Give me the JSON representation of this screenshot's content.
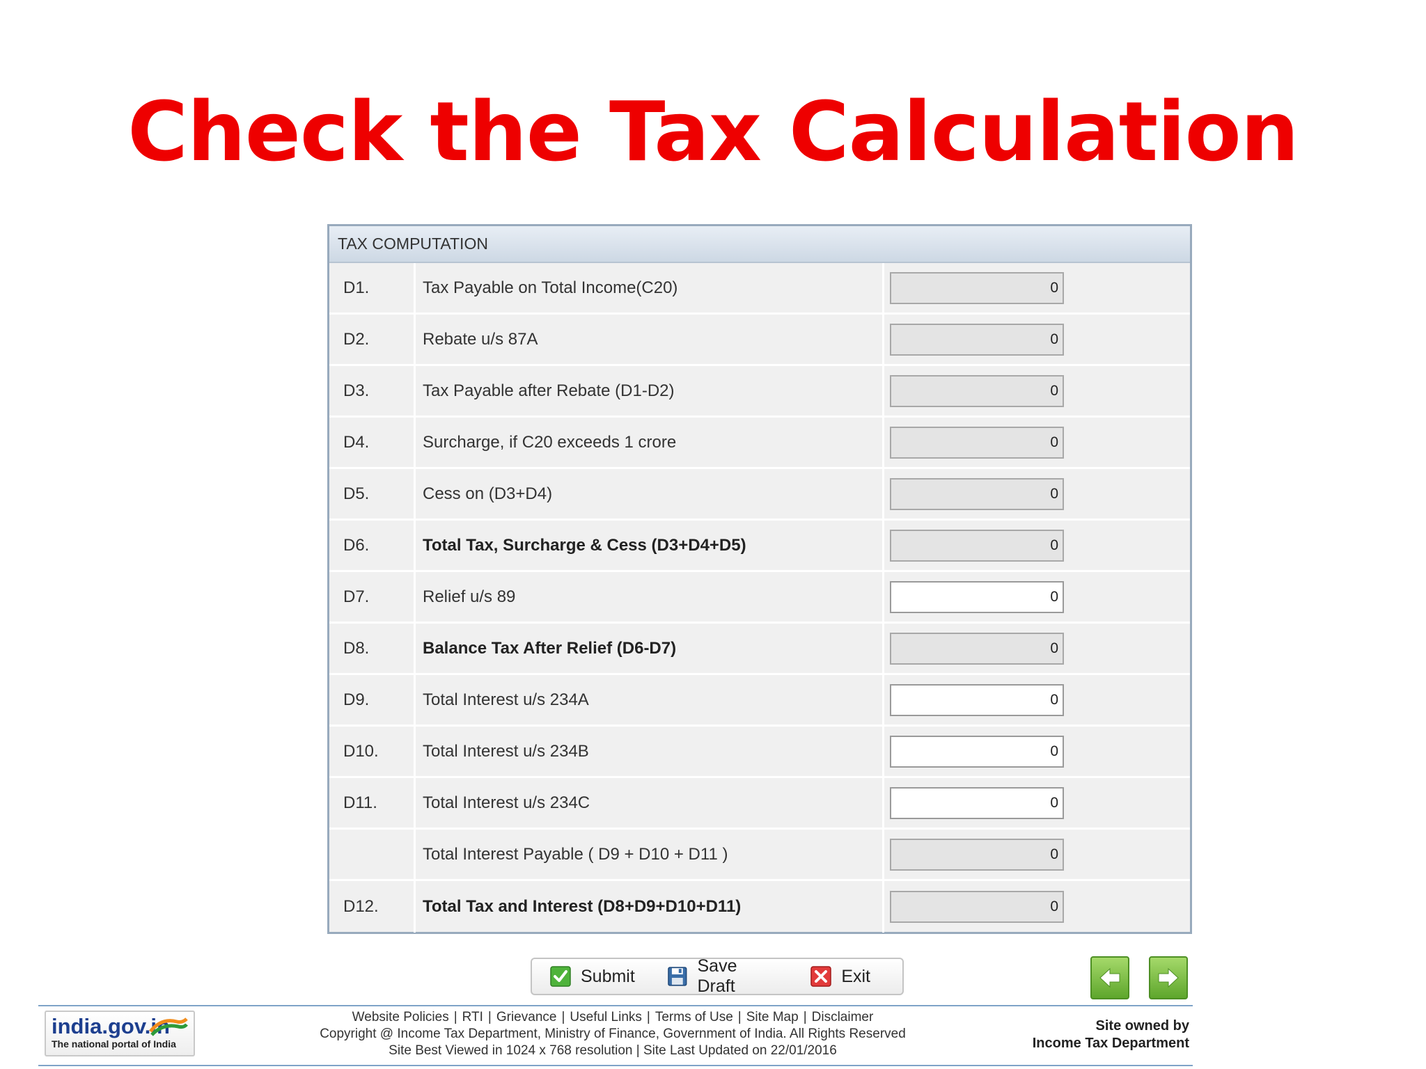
{
  "title": "Check the Tax Calculation",
  "panel": {
    "header": "TAX COMPUTATION",
    "rows": [
      {
        "code": "D1.",
        "label": "Tax Payable on Total Income(C20)",
        "value": "0",
        "bold": false,
        "editable": false
      },
      {
        "code": "D2.",
        "label": "Rebate u/s 87A",
        "value": "0",
        "bold": false,
        "editable": false
      },
      {
        "code": "D3.",
        "label": "Tax Payable after Rebate (D1-D2)",
        "value": "0",
        "bold": false,
        "editable": false
      },
      {
        "code": "D4.",
        "label": "Surcharge, if C20 exceeds 1 crore",
        "value": "0",
        "bold": false,
        "editable": false
      },
      {
        "code": "D5.",
        "label": "Cess on (D3+D4)",
        "value": "0",
        "bold": false,
        "editable": false
      },
      {
        "code": "D6.",
        "label": "Total Tax, Surcharge & Cess (D3+D4+D5)",
        "value": "0",
        "bold": true,
        "editable": false
      },
      {
        "code": "D7.",
        "label": "Relief u/s 89",
        "value": "0",
        "bold": false,
        "editable": true
      },
      {
        "code": "D8.",
        "label": "Balance Tax After Relief (D6-D7)",
        "value": "0",
        "bold": true,
        "editable": false
      },
      {
        "code": "D9.",
        "label": "Total Interest u/s 234A",
        "value": "0",
        "bold": false,
        "editable": true
      },
      {
        "code": "D10.",
        "label": "Total Interest u/s 234B",
        "value": "0",
        "bold": false,
        "editable": true
      },
      {
        "code": "D11.",
        "label": "Total Interest u/s 234C",
        "value": "0",
        "bold": false,
        "editable": true
      },
      {
        "code": "",
        "label": "Total Interest Payable ( D9 + D10 + D11 )",
        "value": "0",
        "bold": false,
        "editable": false
      },
      {
        "code": "D12.",
        "label": "Total Tax and Interest (D8+D9+D10+D11)",
        "value": "0",
        "bold": true,
        "editable": false
      }
    ]
  },
  "actions": {
    "submit": "Submit",
    "save_draft": "Save Draft",
    "exit": "Exit"
  },
  "icons": {
    "submit": "check-icon",
    "save_draft": "floppy-disk-icon",
    "exit": "red-x-icon",
    "prev": "arrow-left-icon",
    "next": "arrow-right-icon"
  },
  "footer": {
    "logo_brand": "india.gov.in",
    "logo_tagline": "The national portal of India",
    "links": [
      "Website Policies",
      "RTI",
      "Grievance",
      "Useful Links",
      "Terms of Use",
      "Site Map",
      "Disclaimer"
    ],
    "copyright": "Copyright @ Income Tax Department, Ministry of Finance, Government of India. All Rights Reserved",
    "best_viewed": "Site Best Viewed in 1024 x 768 resolution | Site Last Updated on 22/01/2016",
    "owner_line1": "Site owned by",
    "owner_line2": "Income Tax Department"
  },
  "colors": {
    "title": "#ee0000",
    "panel_border": "#98aabd",
    "row_bg": "#f0f0f0",
    "nav_green": "#6cb332",
    "logo_blue": "#1d3f8f"
  }
}
